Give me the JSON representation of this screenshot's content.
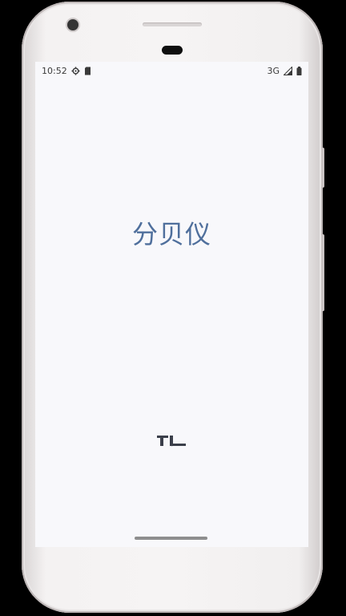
{
  "status_bar": {
    "time": "10:52",
    "network": "3G",
    "icons": [
      "settings-gear-icon",
      "sd-card-icon",
      "signal-icon",
      "battery-icon"
    ]
  },
  "app": {
    "title": "分贝仪",
    "logo_text": "TL",
    "title_color": "#4f6f9c"
  }
}
